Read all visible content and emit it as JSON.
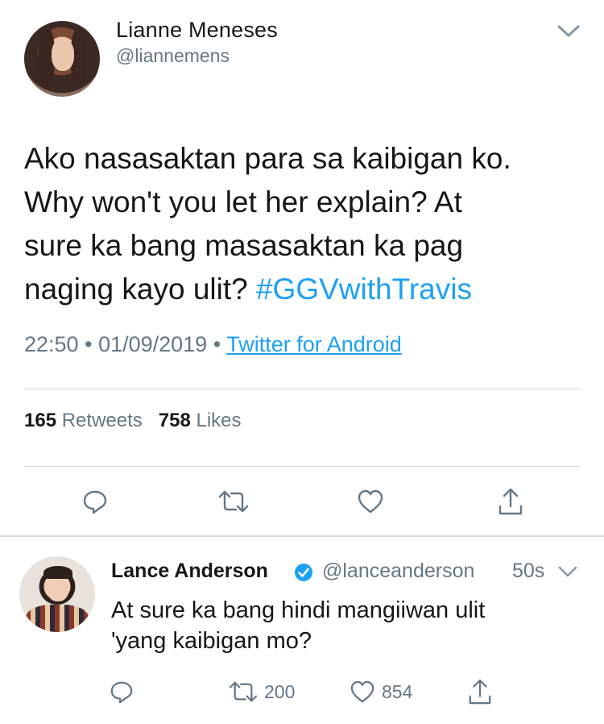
{
  "main_tweet": {
    "author_name": "Lianne Meneses",
    "author_handle": "@liannemens",
    "text_lines": [
      "Ako nasasaktan para sa kaibigan ko.",
      "Why won't you let her explain? At",
      "sure ka bang masasaktan ka pag",
      "naging kayo ulit? "
    ],
    "hashtag": "#GGVwithTravis",
    "time": "22:50",
    "date": "01/09/2019",
    "separator": "•",
    "source": "Twitter for Android",
    "retweets_count": "165",
    "retweets_label": "Retweets",
    "likes_count": "758",
    "likes_label": "Likes",
    "icons": [
      "chevron-down-icon",
      "reply-icon",
      "retweet-icon",
      "like-icon",
      "share-icon"
    ]
  },
  "reply_tweet": {
    "author_name": "Lance Anderson",
    "author_handle": "@lanceanderson",
    "time_ago": "50s",
    "text_lines": [
      "At sure ka bang hindi mangiiwan ulit",
      "'yang kaibigan mo?"
    ],
    "retweet_count": "200",
    "like_count": "854",
    "icons": [
      "verified-badge-icon",
      "chevron-down-icon",
      "reply-icon",
      "retweet-icon",
      "like-icon",
      "share-icon"
    ]
  },
  "colors": {
    "accent": "#1da1f2",
    "secondary_text": "#657786",
    "primary_text": "#14171a",
    "divider": "#d6d9db"
  }
}
